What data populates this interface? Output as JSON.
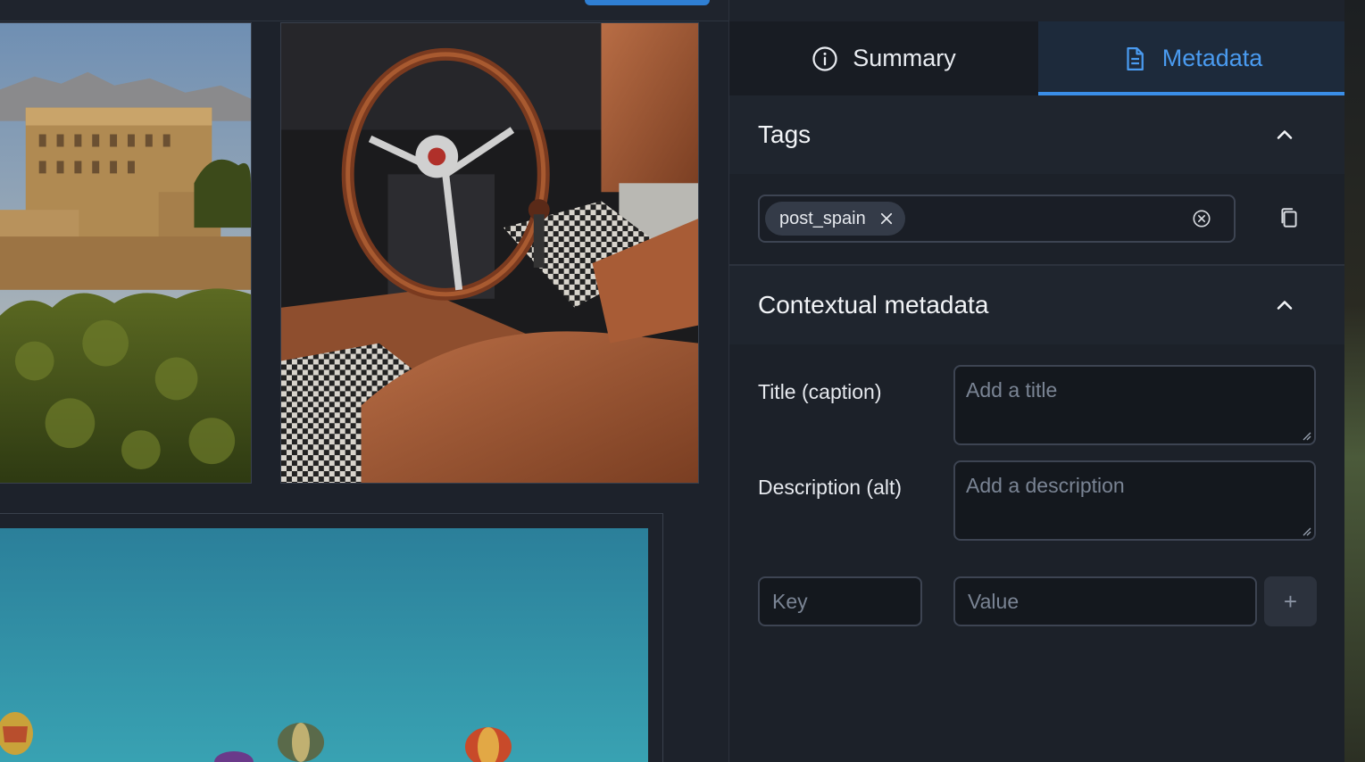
{
  "tabs": [
    {
      "label": "Summary",
      "icon": "info-icon",
      "active": false
    },
    {
      "label": "Metadata",
      "icon": "document-icon",
      "active": true
    }
  ],
  "tags": {
    "heading": "Tags",
    "chips": [
      "post_spain"
    ]
  },
  "contextual": {
    "heading": "Contextual metadata",
    "title_label": "Title (caption)",
    "title_placeholder": "Add a title",
    "description_label": "Description (alt)",
    "description_placeholder": "Add a description",
    "key_placeholder": "Key",
    "value_placeholder": "Value",
    "add_label": "+"
  },
  "colors": {
    "accent": "#3a8ee8",
    "panel_bg": "#1e232c",
    "active_tab_bg": "#1d2a3b"
  }
}
